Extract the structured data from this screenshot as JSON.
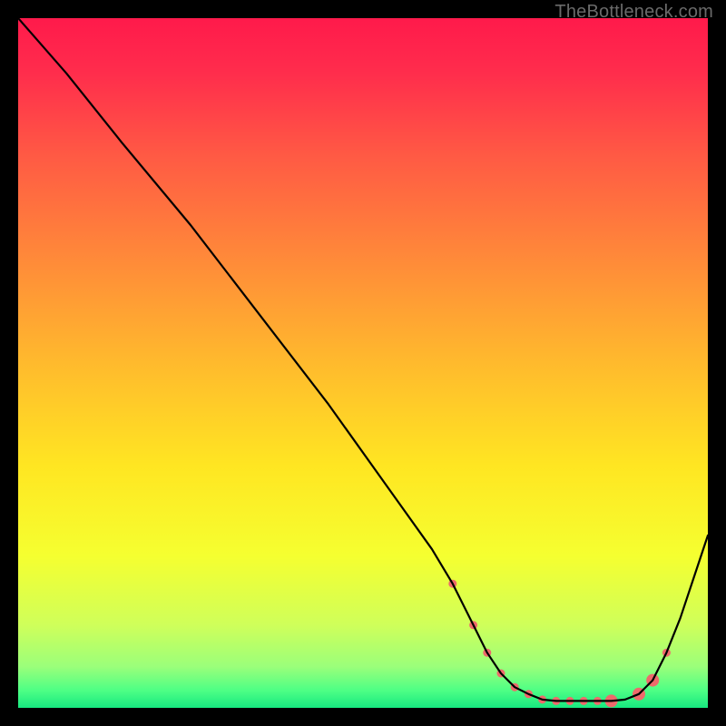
{
  "watermark": "TheBottleneck.com",
  "chart_data": {
    "type": "line",
    "title": "",
    "xlabel": "",
    "ylabel": "",
    "xlim": [
      0,
      100
    ],
    "ylim": [
      0,
      100
    ],
    "series": [
      {
        "name": "curve",
        "x": [
          0,
          7,
          15,
          25,
          35,
          45,
          55,
          60,
          63,
          66,
          68,
          70,
          72,
          74,
          76,
          78,
          80,
          82,
          84,
          86,
          88,
          90,
          92,
          94,
          96,
          98,
          100
        ],
        "y": [
          100,
          92,
          82,
          70,
          57,
          44,
          30,
          23,
          18,
          12,
          8,
          5,
          3,
          2,
          1.2,
          1,
          1,
          1,
          1,
          1,
          1.2,
          2,
          4,
          8,
          13,
          19,
          25
        ]
      }
    ],
    "markers": {
      "name": "highlight-points",
      "color": "#ee6a6b",
      "small_radius": 4.5,
      "large_radius": 7,
      "points": [
        {
          "x": 63,
          "y": 18,
          "size": "small"
        },
        {
          "x": 66,
          "y": 12,
          "size": "small"
        },
        {
          "x": 68,
          "y": 8,
          "size": "small"
        },
        {
          "x": 70,
          "y": 5,
          "size": "small"
        },
        {
          "x": 72,
          "y": 3,
          "size": "small"
        },
        {
          "x": 74,
          "y": 2,
          "size": "small"
        },
        {
          "x": 76,
          "y": 1.2,
          "size": "small"
        },
        {
          "x": 78,
          "y": 1,
          "size": "small"
        },
        {
          "x": 80,
          "y": 1,
          "size": "small"
        },
        {
          "x": 82,
          "y": 1,
          "size": "small"
        },
        {
          "x": 84,
          "y": 1,
          "size": "small"
        },
        {
          "x": 86,
          "y": 1,
          "size": "large"
        },
        {
          "x": 90,
          "y": 2,
          "size": "large"
        },
        {
          "x": 92,
          "y": 4,
          "size": "large"
        },
        {
          "x": 94,
          "y": 8,
          "size": "small"
        }
      ]
    },
    "background_gradient": {
      "stops": [
        {
          "offset": 0.0,
          "color": "#ff1a4b"
        },
        {
          "offset": 0.08,
          "color": "#ff2d4c"
        },
        {
          "offset": 0.2,
          "color": "#ff5a44"
        },
        {
          "offset": 0.35,
          "color": "#ff8a39"
        },
        {
          "offset": 0.5,
          "color": "#ffba2d"
        },
        {
          "offset": 0.65,
          "color": "#ffe622"
        },
        {
          "offset": 0.78,
          "color": "#f5ff30"
        },
        {
          "offset": 0.88,
          "color": "#cfff5a"
        },
        {
          "offset": 0.94,
          "color": "#9bff7a"
        },
        {
          "offset": 0.975,
          "color": "#4dff85"
        },
        {
          "offset": 1.0,
          "color": "#17e880"
        }
      ]
    }
  }
}
